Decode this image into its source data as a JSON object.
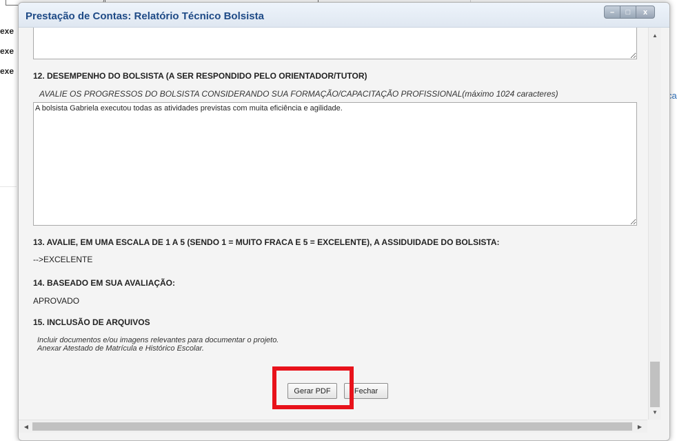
{
  "background": {
    "left_fragments": [
      "exe",
      "exe",
      "exe"
    ],
    "right_fragment": "ca"
  },
  "dialog": {
    "title": "Prestação de Contas: Relatório Técnico Bolsista",
    "window_controls": {
      "minimize_glyph": "–",
      "maximize_glyph": "□",
      "close_glyph": "x"
    }
  },
  "form": {
    "previous_textarea_value": "",
    "section12": {
      "heading": "12. DESEMPENHO DO BOLSISTA (A SER RESPONDIDO PELO ORIENTADOR/TUTOR)",
      "hint": "AVALIE OS PROGRESSOS DO BOLSISTA CONSIDERANDO SUA FORMAÇÃO/CAPACITAÇÃO PROFISSIONAL(máximo 1024 caracteres)",
      "answer": "A bolsista Gabriela executou todas as atividades previstas com muita eficiência e agilidade."
    },
    "section13": {
      "heading": "13. AVALIE, EM UMA ESCALA DE 1 A 5 (SENDO 1 = MUITO FRACA E 5 = EXCELENTE), A ASSIDUIDADE DO BOLSISTA:",
      "answer": "-->EXCELENTE"
    },
    "section14": {
      "heading": "14. BASEADO EM SUA AVALIAÇÃO:",
      "answer": "APROVADO"
    },
    "section15": {
      "heading": "15. INCLUSÃO DE ARQUIVOS",
      "note_line1": "Incluir documentos e/ou imagens relevantes para documentar o projeto.",
      "note_line2": "Anexar Atestado de Matrícula e Histórico Escolar."
    },
    "buttons": {
      "generate_pdf": "Gerar PDF",
      "close": "Fechar"
    }
  },
  "colors": {
    "title_text": "#1e4a86",
    "highlight_box": "#e8121b"
  }
}
